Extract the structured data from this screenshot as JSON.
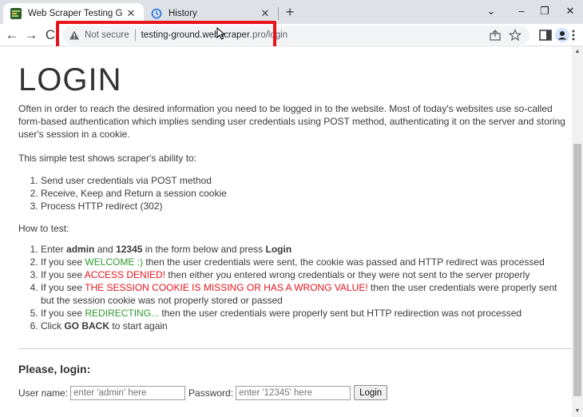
{
  "browser": {
    "tabs": [
      {
        "title": "Web Scraper Testing Ground",
        "active": true,
        "icon": "site-favicon"
      },
      {
        "title": "History",
        "active": false,
        "icon": "history-icon"
      }
    ],
    "window_controls": [
      "chevron-down-icon",
      "minimize-icon",
      "restore-icon",
      "close-icon"
    ],
    "address": {
      "security_label": "Not secure",
      "host": "testing-ground.webscraper",
      "host_suffix": ".pro",
      "path": "/login"
    },
    "highlight_color": "#e8141a"
  },
  "page": {
    "title": "LOGIN",
    "intro": "Often in order to reach the desired information you need to be logged in to the website. Most of today's websites use so-called form-based authentication which implies sending user credentials using POST method, authenticating it on the server and storing user's session in a cookie.",
    "test_intro": "This simple test shows scraper's ability to:",
    "abilities": [
      "Send user credentials via POST method",
      "Receive, Keep and Return a session cookie",
      "Process HTTP redirect (302)"
    ],
    "how_to_label": "How to test:",
    "steps": {
      "s1_pre": "Enter ",
      "s1_user": "admin",
      "s1_and": " and ",
      "s1_pass": "12345",
      "s1_mid": " in the form below and press ",
      "s1_btn": "Login",
      "s2_pre": "If you see ",
      "s2_hl": "WELCOME :)",
      "s2_post": " then the user credentials were sent, the cookie was passed and HTTP redirect was processed",
      "s3_pre": "If you see ",
      "s3_hl": "ACCESS DENIED!",
      "s3_post": " then either you entered wrong credentials or they were not sent to the server properly",
      "s4_pre": "If you see ",
      "s4_hl": "THE SESSION COOKIE IS MISSING OR HAS A WRONG VALUE!",
      "s4_post": " then the user credentials were properly sent but the session cookie was not properly stored or passed",
      "s5_pre": "If you see ",
      "s5_hl": "REDIRECTING...",
      "s5_post": " then the user credentials were properly sent but HTTP redirection was not processed",
      "s6_pre": "Click ",
      "s6_hl": "GO BACK",
      "s6_post": " to start again"
    },
    "login_heading": "Please, login:",
    "form": {
      "username_label": "User name:",
      "username_placeholder": "enter 'admin' here",
      "password_label": "Password:",
      "password_placeholder": "enter '12345' here",
      "submit_label": "Login"
    }
  }
}
